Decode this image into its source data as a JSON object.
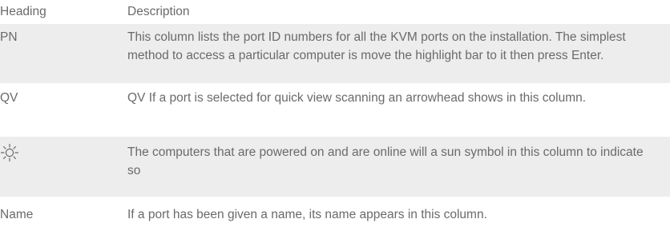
{
  "header": {
    "col1": "Heading",
    "col2": "Description"
  },
  "rows": [
    {
      "heading": "PN",
      "description": "This column lists the port ID numbers for all the KVM ports on the installation. The simplest method to access a particular computer is move the highlight bar to it then press Enter."
    },
    {
      "heading": "QV",
      "description": "QV If a port is selected for quick view scanning an arrowhead shows in this column."
    },
    {
      "heading_icon": "sun-icon",
      "description": "The computers that are powered on and are online will a sun symbol in this column to indicate so"
    },
    {
      "heading": "Name",
      "description": "If a port has been given a name, its name appears in this column."
    }
  ],
  "colors": {
    "text": "#6a6a6a",
    "shaded_row": "#ededee",
    "background": "#ffffff"
  }
}
